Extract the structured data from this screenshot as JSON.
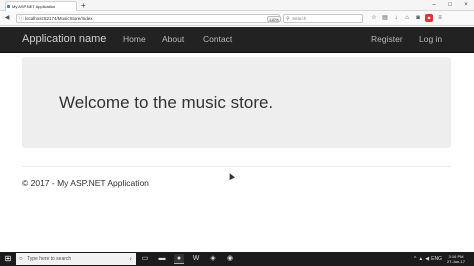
{
  "browser": {
    "tab_title": "My ASP.NET Application",
    "tab_close": "×",
    "new_tab": "+",
    "window_controls": [
      "–",
      "□",
      "×"
    ],
    "url": "localhost:52174/MusicStore/Index",
    "zoom": "110%",
    "search_placeholder": "Search",
    "toolbar_icons": [
      "star-icon",
      "bookmark-icon",
      "download-icon",
      "home-icon",
      "pocket-icon",
      "shield-icon",
      "menu-icon"
    ]
  },
  "site": {
    "brand": "Application name",
    "nav_links": [
      "Home",
      "About",
      "Contact"
    ],
    "auth_links": [
      "Register",
      "Log in"
    ],
    "jumbotron_heading": "Welcome to the music store.",
    "footer": "© 2017 - My ASP.NET Application"
  },
  "taskbar": {
    "search_placeholder": "Type here to search",
    "language": "ENG",
    "time": "3:16 PM",
    "date": "27-Jun-17"
  },
  "colors": {
    "navbar_bg": "#222222",
    "nav_text": "#b9b9b9",
    "jumbotron_bg": "#eeeeee",
    "taskbar_bg": "#1b1b1b"
  }
}
